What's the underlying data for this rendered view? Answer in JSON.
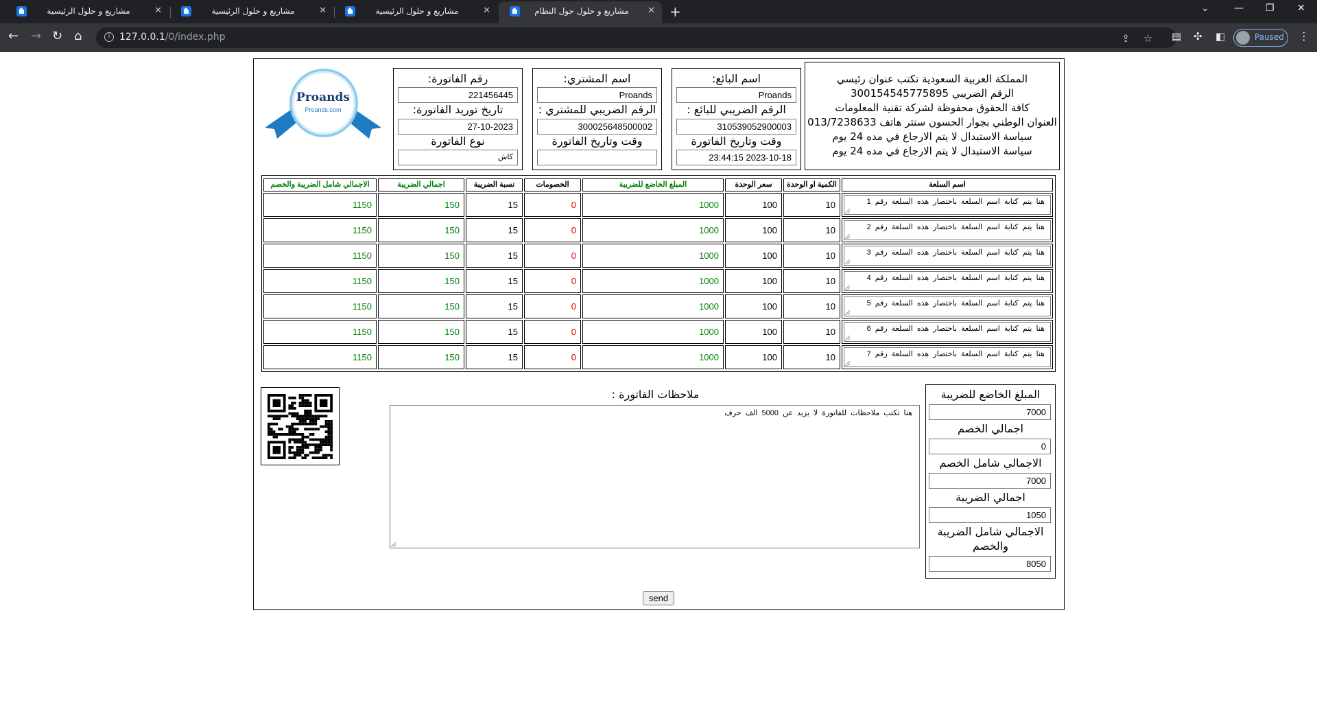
{
  "browser": {
    "tabs": [
      {
        "title": "مشاريع و حلول الرئيسية",
        "close": "✕"
      },
      {
        "title": "مشاريع و حلول الرئيسية",
        "close": "✕"
      },
      {
        "title": "مشاريع و حلول الرئيسية",
        "close": "✕"
      },
      {
        "title": "مشاريع و حلول حول النظام",
        "close": "✕"
      }
    ],
    "url_host": "127.0.0.1",
    "url_path": "/0/index.php",
    "profile_label": "Paused"
  },
  "company": {
    "lines": [
      "المملكة العربية السعودية تكتب عنوان رئيسي",
      "الرقم الضريبي 300154545775895",
      "كافة الحقوق محفوظة لشركة تقنية المعلومات",
      "العنوان الوطني بجوار الحسون سنتر هاتف 013/7238633",
      "سياسة الاستبدال لا يتم الارجاع في مده 24 يوم",
      "سياسة الاستبدال لا يتم الارجاع في مده 24 يوم"
    ]
  },
  "seller": {
    "name_label": "اسم البائع:",
    "name_value": "Proands",
    "tax_label": "الرقم الضريبي للبائع :",
    "tax_value": "310539052900003",
    "datetime_label": "وقت وتاريخ الفاتورة",
    "datetime_value": "23:44:15 2023-10-18"
  },
  "buyer": {
    "name_label": "اسم المشتري:",
    "name_value": "Proands",
    "tax_label": "الرقم الضريبي للمشتري :",
    "tax_value": "300025648500002",
    "datetime_label": "وقت وتاريخ الفاتورة",
    "datetime_value": ""
  },
  "invoice": {
    "number_label": "رقم الفاتورة:",
    "number_value": "221456445",
    "supply_date_label": "تاريخ توريد الفاتورة:",
    "supply_date_value": "27-10-2023",
    "type_label": "نوع الفاتورة",
    "type_value": "كاش"
  },
  "logo": {
    "brand": "Proands",
    "site": "Proands.com",
    "ribbon_color": "#1e7bc4"
  },
  "table": {
    "headers": {
      "name": "اسم السلعة",
      "qty": "الكمية او الوحدة",
      "unit_price": "سعر الوحدة",
      "taxable": "المبلغ الخاضع للضريبة",
      "discounts": "الخصومات",
      "tax_rate": "نسبة الضريبة",
      "tax_total": "اجمالي الضريبة",
      "grand_total": "الاجمالي شامل الضريبة والخصم"
    },
    "rows": [
      {
        "name": "هنا يتم كتابة اسم السلعة باختصار هذه السلعة رقم 1",
        "qty": "10",
        "unit_price": "100",
        "taxable": "1000",
        "discounts": "0",
        "tax_rate": "15",
        "tax_total": "150",
        "grand_total": "1150"
      },
      {
        "name": "هنا يتم كتابة اسم السلعة باختصار هذه السلعة رقم 2",
        "qty": "10",
        "unit_price": "100",
        "taxable": "1000",
        "discounts": "0",
        "tax_rate": "15",
        "tax_total": "150",
        "grand_total": "1150"
      },
      {
        "name": "هنا يتم كتابة اسم السلعة باختصار هذه السلعة رقم 3",
        "qty": "10",
        "unit_price": "100",
        "taxable": "1000",
        "discounts": "0",
        "tax_rate": "15",
        "tax_total": "150",
        "grand_total": "1150"
      },
      {
        "name": "هنا يتم كتابة اسم السلعة باختصار هذه السلعة رقم 4",
        "qty": "10",
        "unit_price": "100",
        "taxable": "1000",
        "discounts": "0",
        "tax_rate": "15",
        "tax_total": "150",
        "grand_total": "1150"
      },
      {
        "name": "هنا يتم كتابة اسم السلعة باختصار هذه السلعة رقم 5",
        "qty": "10",
        "unit_price": "100",
        "taxable": "1000",
        "discounts": "0",
        "tax_rate": "15",
        "tax_total": "150",
        "grand_total": "1150"
      },
      {
        "name": "هنا يتم كتابة اسم السلعة باختصار هذه السلعة رقم 6",
        "qty": "10",
        "unit_price": "100",
        "taxable": "1000",
        "discounts": "0",
        "tax_rate": "15",
        "tax_total": "150",
        "grand_total": "1150"
      },
      {
        "name": "هنا يتم كتابة اسم السلعة باختصار هذه السلعة رقم 7",
        "qty": "10",
        "unit_price": "100",
        "taxable": "1000",
        "discounts": "0",
        "tax_rate": "15",
        "tax_total": "150",
        "grand_total": "1150"
      }
    ]
  },
  "notes": {
    "label": "ملاحظات الفاتورة :",
    "value": "هنا تكتب ملاحظات للفاتورة لا يزيد عن 5000 الف حرف"
  },
  "totals": {
    "taxable_label": "المبلغ الخاضع للضريبة",
    "taxable_value": "7000",
    "discount_label": "اجمالي الخصم",
    "discount_value": "0",
    "after_discount_label": "الاجمالي شامل الخصم",
    "after_discount_value": "7000",
    "tax_label": "اجمالي الضريبة",
    "tax_value": "1050",
    "grand_label_1": "الاجمالي شامل الضريبة",
    "grand_label_2": "والخصم",
    "grand_value": "8050"
  },
  "send_label": "send",
  "colors": {
    "green": "#008000",
    "red": "#e00000"
  }
}
